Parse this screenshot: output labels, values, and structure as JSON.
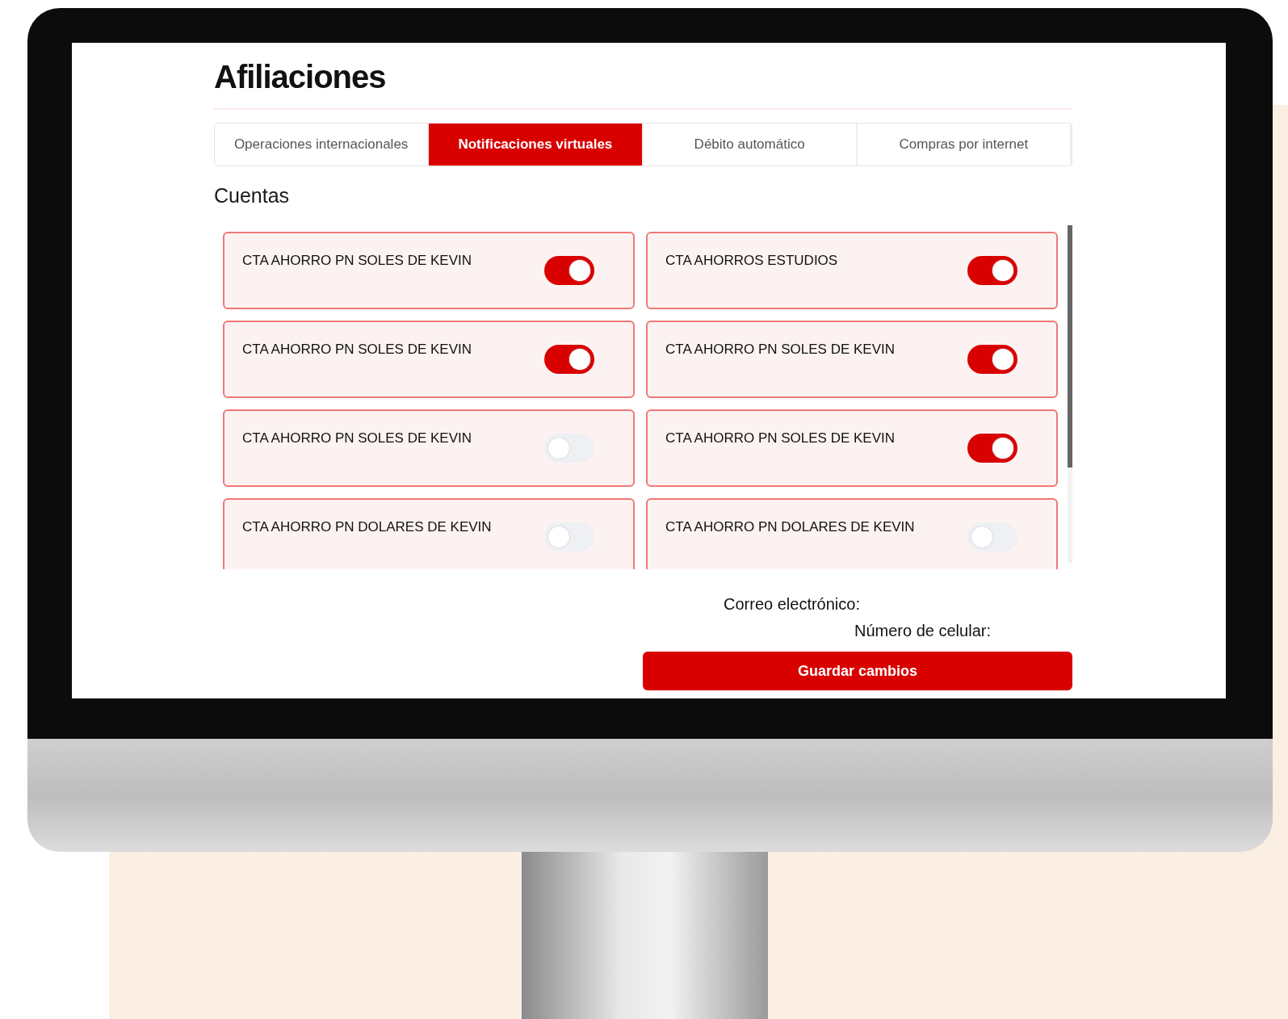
{
  "page": {
    "title": "Afiliaciones"
  },
  "tabs": [
    {
      "label": "Operaciones internacionales",
      "selected": false
    },
    {
      "label": "Notificaciones virtuales",
      "selected": true
    },
    {
      "label": "Débito automático",
      "selected": false
    },
    {
      "label": "Compras por internet",
      "selected": false
    }
  ],
  "section_title": "Cuentas",
  "accounts": [
    {
      "name": "CTA AHORRO PN SOLES DE KEVIN",
      "on": true
    },
    {
      "name": "CTA AHORROS ESTUDIOS",
      "on": true
    },
    {
      "name": "CTA AHORRO PN SOLES DE KEVIN",
      "on": true
    },
    {
      "name": "CTA AHORRO PN SOLES DE KEVIN",
      "on": true
    },
    {
      "name": "CTA AHORRO PN SOLES DE KEVIN",
      "on": false
    },
    {
      "name": "CTA AHORRO PN SOLES DE KEVIN",
      "on": true
    },
    {
      "name": "CTA AHORRO PN DOLARES DE KEVIN",
      "on": false
    },
    {
      "name": "CTA AHORRO PN DOLARES DE KEVIN",
      "on": false
    }
  ],
  "contact": {
    "email_label": "Correo electrónico:",
    "phone_label": "Número de celular:"
  },
  "save_button": "Guardar cambios"
}
